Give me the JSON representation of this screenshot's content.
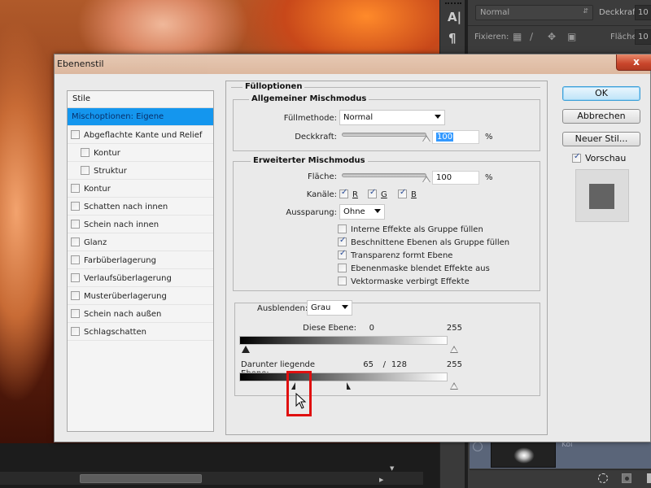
{
  "photoshop": {
    "blend_mode": "Normal",
    "opacity_label": "Deckkraft:",
    "opacity_value": "10",
    "lock_label": "Fixieren:",
    "fill_label": "Fläche:",
    "fill_value": "10",
    "layer_name": "Kol",
    "icons": [
      "transparency-lock-icon",
      "brush-icon",
      "move-icon",
      "lock-icon"
    ]
  },
  "dialog": {
    "title": "Ebenenstil",
    "close_label": "x",
    "styles_header": "Stile",
    "styles": [
      {
        "label": "Mischoptionen: Eigene",
        "selected": true,
        "checkbox": false,
        "indent": false
      },
      {
        "label": "Abgeflachte Kante und Relief",
        "checkbox": true,
        "checked": false,
        "indent": false
      },
      {
        "label": "Kontur",
        "checkbox": true,
        "checked": false,
        "indent": true
      },
      {
        "label": "Struktur",
        "checkbox": true,
        "checked": false,
        "indent": true
      },
      {
        "label": "Kontur",
        "checkbox": true,
        "checked": false,
        "indent": false
      },
      {
        "label": "Schatten nach innen",
        "checkbox": true,
        "checked": false,
        "indent": false
      },
      {
        "label": "Schein nach innen",
        "checkbox": true,
        "checked": false,
        "indent": false
      },
      {
        "label": "Glanz",
        "checkbox": true,
        "checked": false,
        "indent": false
      },
      {
        "label": "Farbüberlagerung",
        "checkbox": true,
        "checked": false,
        "indent": false
      },
      {
        "label": "Verlaufsüberlagerung",
        "checkbox": true,
        "checked": false,
        "indent": false
      },
      {
        "label": "Musterüberlagerung",
        "checkbox": true,
        "checked": false,
        "indent": false
      },
      {
        "label": "Schein nach außen",
        "checkbox": true,
        "checked": false,
        "indent": false
      },
      {
        "label": "Schlagschatten",
        "checkbox": true,
        "checked": false,
        "indent": false
      }
    ],
    "fill_options": {
      "title": "Fülloptionen",
      "general": {
        "title": "Allgemeiner Mischmodus",
        "fill_method_label": "Füllmethode:",
        "fill_method_value": "Normal",
        "opacity_label": "Deckkraft:",
        "opacity_value": "100",
        "opacity_percent": 100,
        "percent_sign": "%"
      },
      "advanced": {
        "title": "Erweiterter Mischmodus",
        "fill_label": "Fläche:",
        "fill_value": "100",
        "fill_percent": 100,
        "percent_sign": "%",
        "channels_label": "Kanäle:",
        "channels": [
          {
            "label": "R",
            "checked": true
          },
          {
            "label": "G",
            "checked": true
          },
          {
            "label": "B",
            "checked": true
          }
        ],
        "knockout_label": "Aussparung:",
        "knockout_value": "Ohne",
        "options": [
          {
            "label": "Interne Effekte als Gruppe füllen",
            "checked": false
          },
          {
            "label": "Beschnittene Ebenen als Gruppe füllen",
            "checked": true
          },
          {
            "label": "Transparenz formt Ebene",
            "checked": true
          },
          {
            "label": "Ebenenmaske blendet Effekte aus",
            "checked": false
          },
          {
            "label": "Vektormaske verbirgt Effekte",
            "checked": false
          }
        ]
      },
      "blend_if": {
        "label": "Ausblenden:",
        "value": "Grau",
        "this_layer_label": "Diese Ebene:",
        "this_layer_low": "0",
        "this_layer_high": "255",
        "underlying_label": "Darunter liegende Ebene:",
        "underlying_low": "65",
        "underlying_sep": "/",
        "underlying_low2": "128",
        "underlying_high": "255"
      }
    },
    "buttons": {
      "ok": "OK",
      "cancel": "Abbrechen",
      "new_style": "Neuer Stil...",
      "preview_label": "Vorschau",
      "preview_checked": true
    }
  }
}
